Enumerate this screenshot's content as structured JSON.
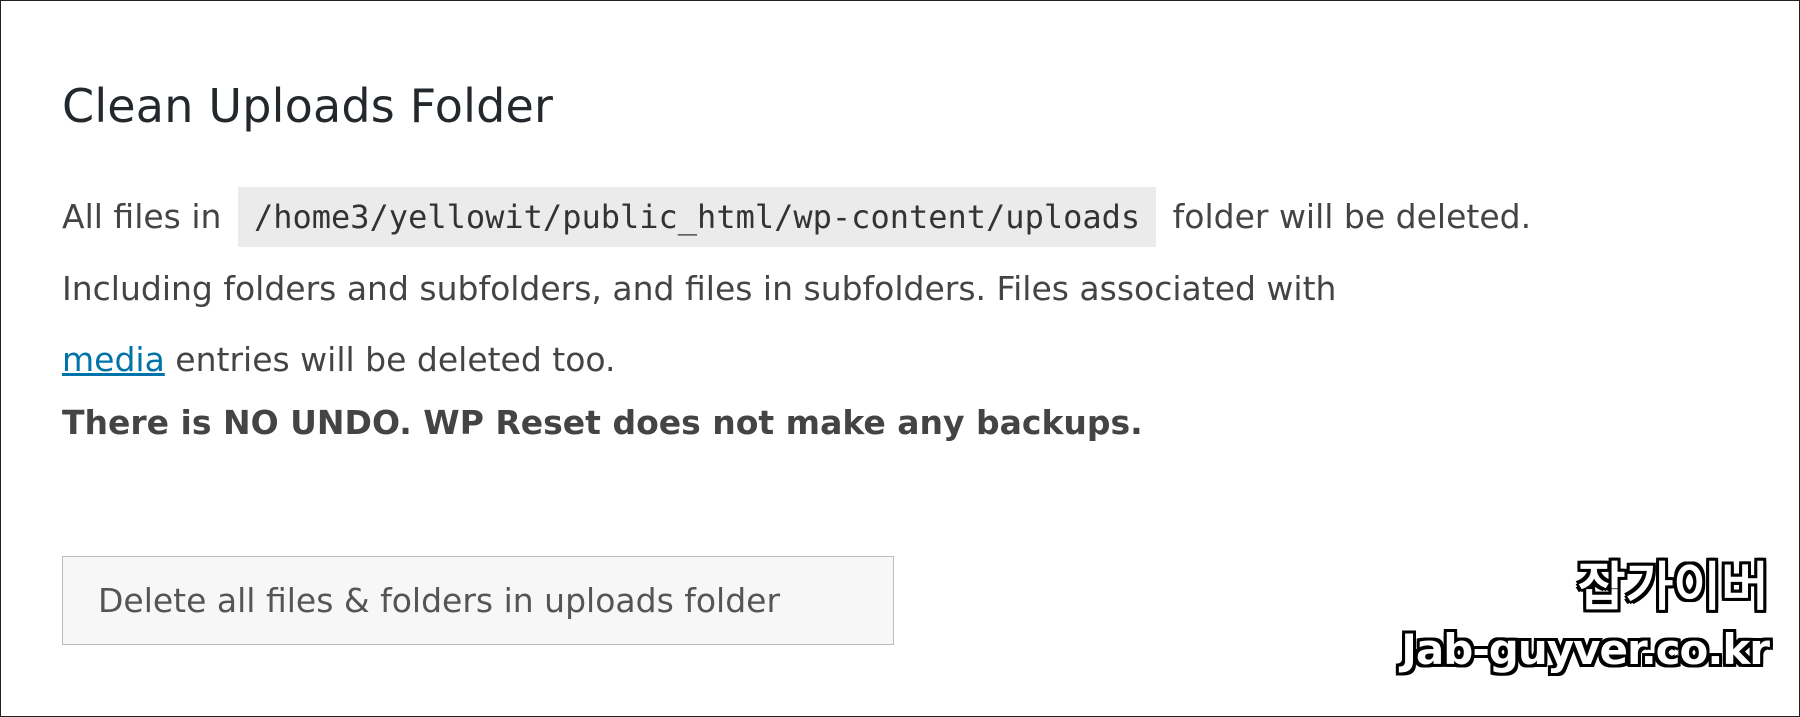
{
  "section": {
    "title": "Clean Uploads Folder",
    "description_prefix": "All files in",
    "uploads_path": "/home3/yellowit/public_html/wp-content/uploads",
    "description_middle": "folder will be deleted. Including folders and subfolders, and files in subfolders. Files associated with",
    "media_link_text": "media",
    "description_suffix": "entries will be deleted too.",
    "warning": "There is NO UNDO. WP Reset does not make any backups."
  },
  "actions": {
    "delete_button_label": "Delete all files & folders in uploads folder"
  },
  "watermark": {
    "korean": "잡가이버",
    "domain": "Jab-guyver.co.kr"
  },
  "colors": {
    "heading": "#23282d",
    "body_text": "#444444",
    "link": "#0073aa",
    "code_background": "#ebebeb",
    "button_background": "#f7f7f7",
    "button_border": "#bdbdbd"
  }
}
